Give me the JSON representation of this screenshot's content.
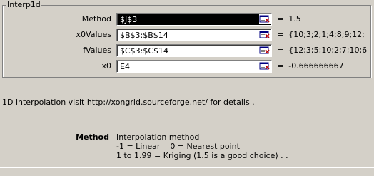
{
  "group": {
    "title": "Interp1d"
  },
  "arguments": [
    {
      "label": "Method",
      "value": "$J$3",
      "result": "1.5",
      "selected": true
    },
    {
      "label": "x0Values",
      "value": "$B$3:$B$14",
      "result": "{10;3;2;1;4;8;9;12;",
      "selected": false
    },
    {
      "label": "fValues",
      "value": "$C$3:$C$14",
      "result": "{12;3;5;10;2;7;10;6",
      "selected": false
    },
    {
      "label": "x0",
      "value": "E4",
      "result": "-0.666666667",
      "selected": false
    }
  ],
  "equals": "=",
  "description": "1D interpolation visit http://xongrid.sourceforge.net/ for details .",
  "parameter": {
    "name": "Method",
    "lines": [
      "Interpolation method",
      "-1 = Linear    0 = Nearest point",
      "1 to 1.99 = Kriging (1.5 is a good choice) . ."
    ]
  },
  "icons": {
    "collapse_dialog": "collapse-dialog-icon"
  }
}
